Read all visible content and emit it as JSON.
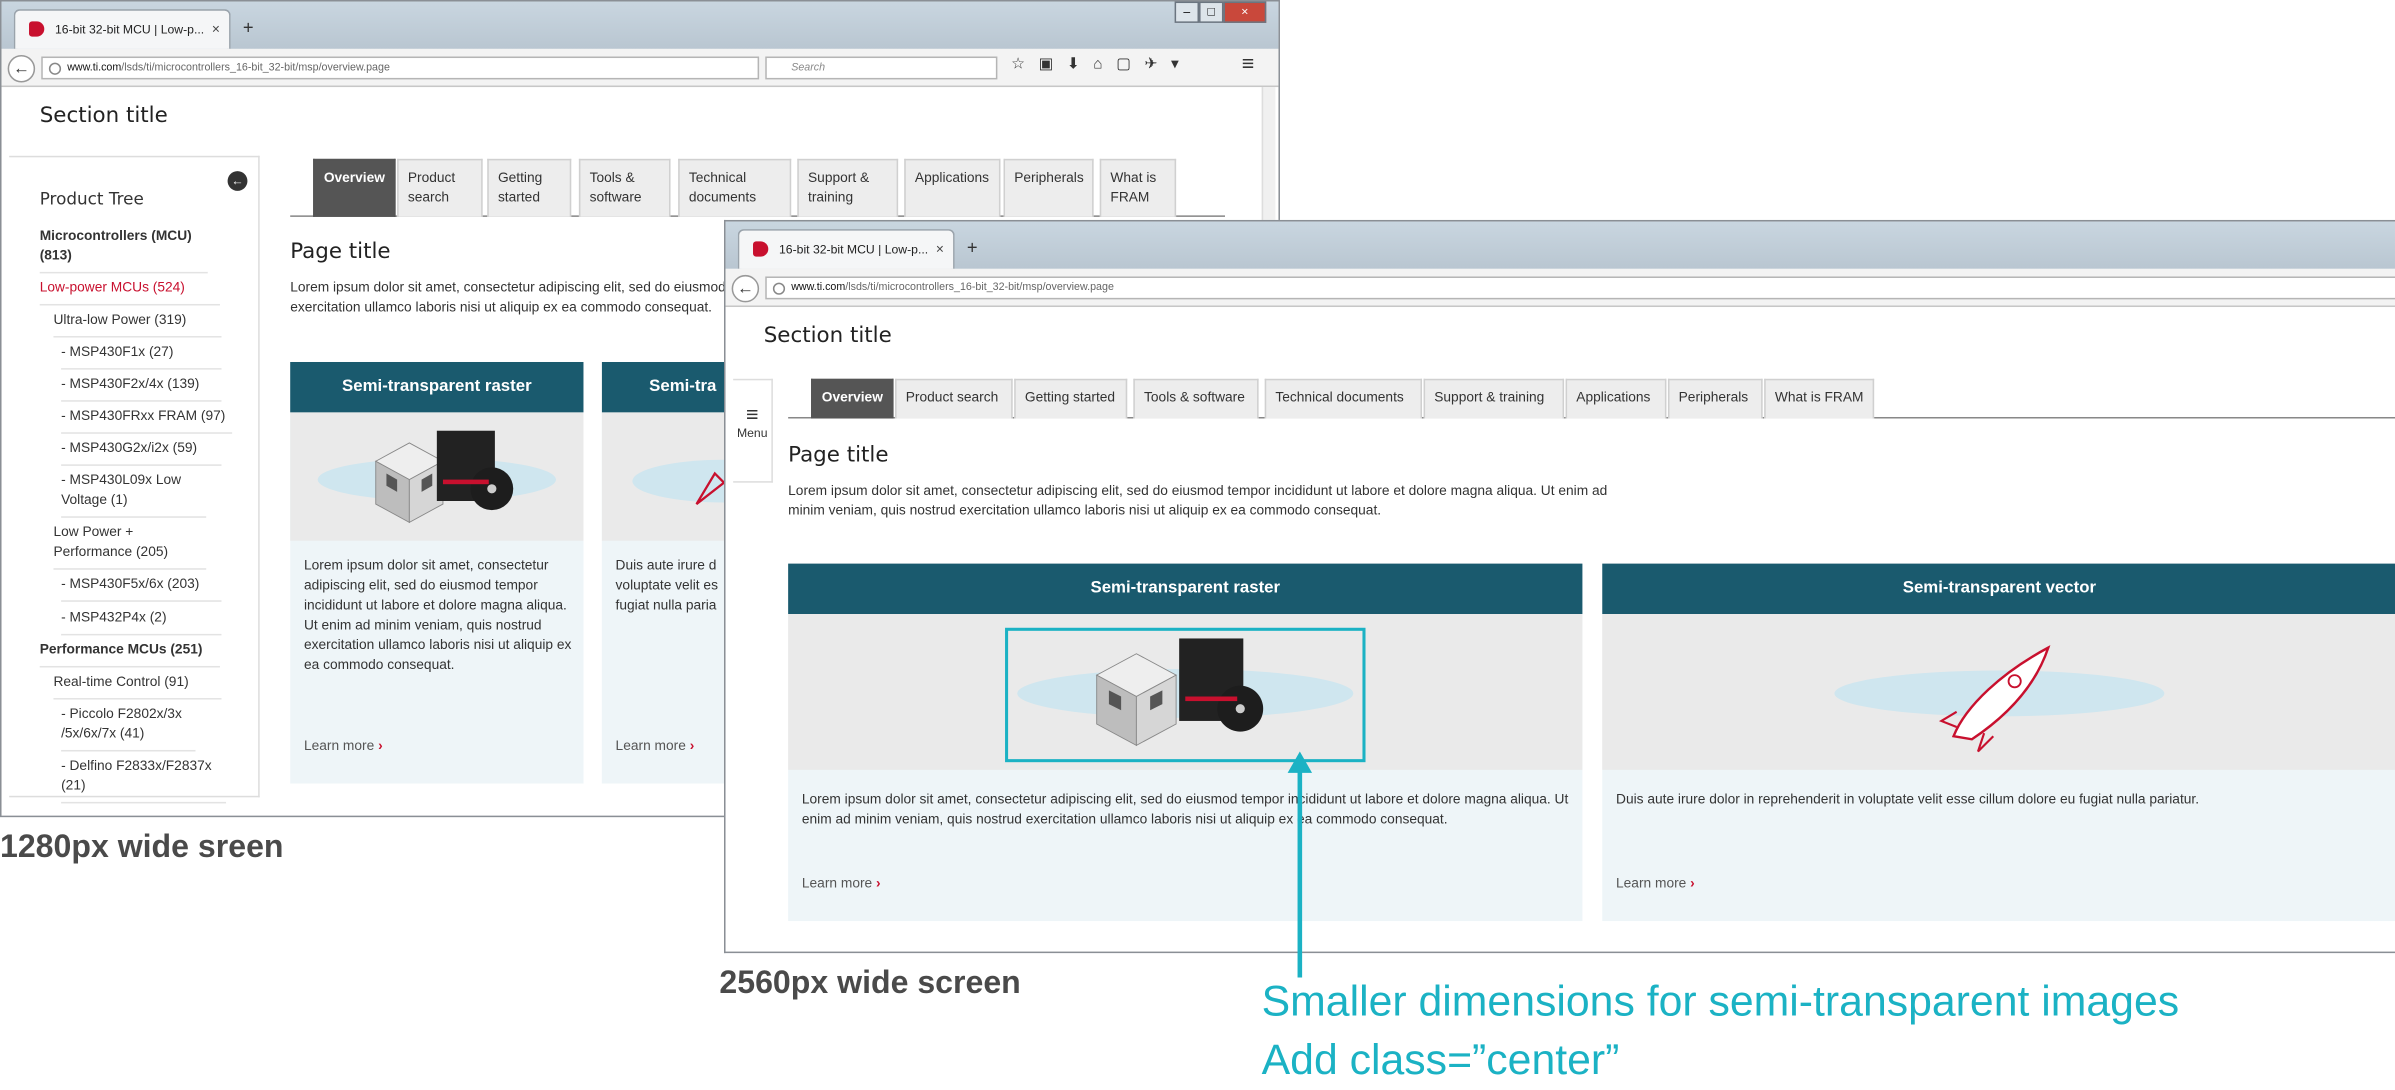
{
  "colors": {
    "accent_red": "#c8102e",
    "card_header": "#1a5a6e",
    "callout": "#1bb2c4",
    "card_bg": "#eef5f8"
  },
  "browser": {
    "tab_title": "16-bit 32-bit MCU | Low-p...",
    "tab_close": "×",
    "new_tab": "+",
    "url_domain": "www.ti.com",
    "url_path": "/lsds/ti/microcontrollers_16-bit_32-bit/msp/overview.page",
    "search_placeholder": "Search",
    "menu_icon": "≡"
  },
  "page": {
    "section_title": "Section title",
    "page_title": "Page title",
    "intro_small": "Lorem ipsum dolor sit amet, consectetur adipiscing elit, sed do eiusmod tempor incididunt ut labore et dolore magna aliqua. Ut enim ad minim veniam, quis nostrud exercitation ullamco laboris nisi ut aliquip ex ea commodo consequat.",
    "tabs_small": [
      "Overview",
      "Product search",
      "Getting started",
      "Tools & software",
      "Technical documents",
      "Support & training",
      "Applications",
      "Peripherals",
      "What is FRAM"
    ],
    "tabs_large": [
      "Overview",
      "Product search",
      "Getting started",
      "Tools & software",
      "Technical documents",
      "Support & training",
      "Applications",
      "Peripherals",
      "What is FRAM"
    ],
    "menu_label": "Menu"
  },
  "sidebar": {
    "heading": "Product Tree",
    "items": [
      {
        "label": "Microcontrollers (MCU) (813)"
      },
      {
        "label": "Low-power MCUs  (524)"
      },
      {
        "label": "Ultra-low Power  (319)"
      },
      {
        "label": "- MSP430F1x  (27)"
      },
      {
        "label": "- MSP430F2x/4x  (139)"
      },
      {
        "label": "- MSP430FRxx FRAM  (97)"
      },
      {
        "label": "- MSP430G2x/i2x  (59)"
      },
      {
        "label": "- MSP430L09x Low Voltage  (1)"
      },
      {
        "label": "Low Power + Performance  (205)"
      },
      {
        "label": "- MSP430F5x/6x  (203)"
      },
      {
        "label": "- MSP432P4x  (2)"
      },
      {
        "label": "Performance MCUs  (251)"
      },
      {
        "label": "Real-time Control  (91)"
      },
      {
        "label": "- Piccolo F2802x/3x /5x/6x/7x  (41)"
      },
      {
        "label": "- Delfino F2833x/F2837x (21)"
      }
    ]
  },
  "cards": [
    {
      "title": "Semi-transparent raster",
      "text_small": "Lorem ipsum dolor sit amet, consectetur adipiscing elit, sed do eiusmod tempor incididunt ut labore et dolore magna aliqua. Ut enim ad minim veniam, quis nostrud exercitation ullamco laboris nisi ut aliquip ex ea commodo consequat.",
      "text_large": "Lorem ipsum dolor sit amet, consectetur adipiscing elit, sed do eiusmod tempor incididunt ut labore et dolore magna aliqua. Ut enim ad minim veniam, quis nostrud exercitation ullamco laboris nisi ut aliquip ex ea commodo consequat.",
      "link": "Learn more"
    },
    {
      "title": "Semi-transparent vector",
      "title_small": "Semi-tra",
      "text_small": "Duis aute irure d voluptate velit es fugiat nulla paria",
      "text_large": "Duis aute irure dolor in reprehenderit in voluptate velit esse cillum dolore eu fugiat nulla pariatur.",
      "link": "Learn more"
    }
  ],
  "annotations": {
    "small_label": "1280px wide sreen",
    "large_label": "2560px wide screen",
    "callout_line1": "Smaller dimensions for semi-transparent images",
    "callout_line2": "Add class=”center”"
  }
}
